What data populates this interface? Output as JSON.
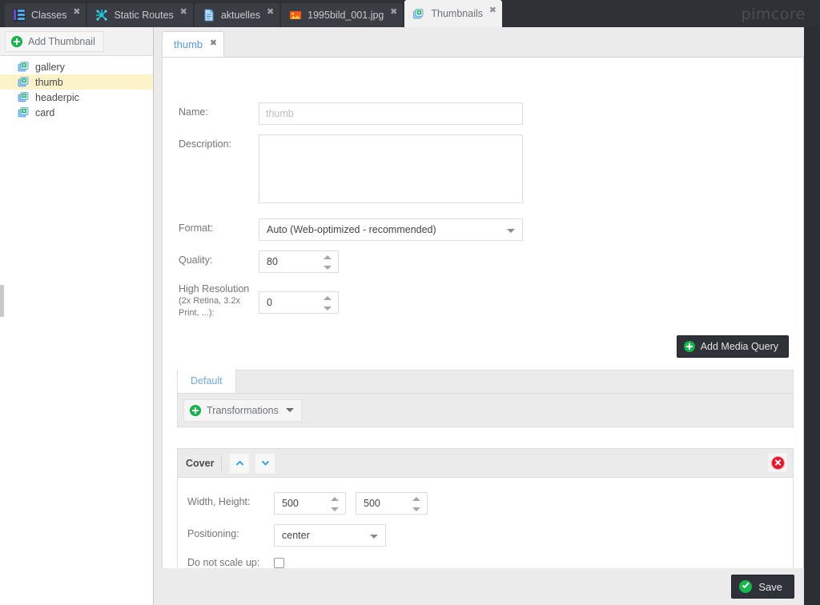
{
  "app": {
    "brand": "pimcore",
    "tabs": [
      {
        "label": "Classes",
        "icon": "classes-icon",
        "active": false
      },
      {
        "label": "Static Routes",
        "icon": "routes-icon",
        "active": false
      },
      {
        "label": "aktuelles",
        "icon": "document-icon",
        "active": false
      },
      {
        "label": "1995bild_001.jpg",
        "icon": "image-icon",
        "active": false
      },
      {
        "label": "Thumbnails",
        "icon": "thumbnails-icon",
        "active": true
      }
    ],
    "close_glyph": "✖"
  },
  "sidebar": {
    "add_button": {
      "label": "Add Thumbnail",
      "icon": "plus-circle-icon"
    },
    "items": [
      {
        "label": "gallery",
        "icon": "thumbnail-item-icon",
        "selected": false
      },
      {
        "label": "thumb",
        "icon": "thumbnail-item-icon",
        "selected": true
      },
      {
        "label": "headerpic",
        "icon": "thumbnail-item-icon",
        "selected": false
      },
      {
        "label": "card",
        "icon": "thumbnail-item-icon",
        "selected": false
      }
    ]
  },
  "editor": {
    "tab": {
      "label": "thumb",
      "close_glyph": "✖"
    },
    "fields": {
      "name": {
        "label": "Name:",
        "value": "",
        "placeholder": "thumb"
      },
      "description": {
        "label": "Description:",
        "value": "",
        "placeholder": ""
      },
      "format": {
        "label": "Format:",
        "value": "Auto (Web-optimized - recommended)"
      },
      "quality": {
        "label": "Quality:",
        "value": "80"
      },
      "high_resolution": {
        "label_line1": "High Resolution",
        "label_line2": "(2x Retina, 3.2x",
        "label_line3": "Print, ...):",
        "value": "0"
      }
    },
    "add_media_query": {
      "label": "Add Media Query",
      "icon": "plus-circle-icon"
    },
    "media_query_tabs": [
      {
        "label": "Default",
        "active": true
      }
    ],
    "transformations": {
      "label": "Transformations",
      "icon": "plus-circle-icon",
      "caret": "chevron-down-icon"
    }
  },
  "cover": {
    "title": "Cover",
    "move_up": {
      "icon": "chevron-up-icon"
    },
    "move_down": {
      "icon": "chevron-down-icon"
    },
    "delete": {
      "icon": "delete-circle-icon"
    },
    "width_height": {
      "label": "Width, Height:",
      "width": "500",
      "height": "500"
    },
    "positioning": {
      "label": "Positioning:",
      "value": "center"
    },
    "do_not_scale_up": {
      "label": "Do not scale up:",
      "checked": false
    }
  },
  "footer": {
    "save": {
      "label": "Save",
      "icon": "check-circle-icon"
    }
  },
  "colors": {
    "chrome_dark": "#2e3135",
    "tab_inactive": "#3a3e44",
    "accent_blue": "#5a9ae0",
    "accent_green": "#15b84a",
    "accent_red": "#e8142c",
    "selected_row": "#fdf3c9",
    "panel_grey": "#ebebeb"
  }
}
